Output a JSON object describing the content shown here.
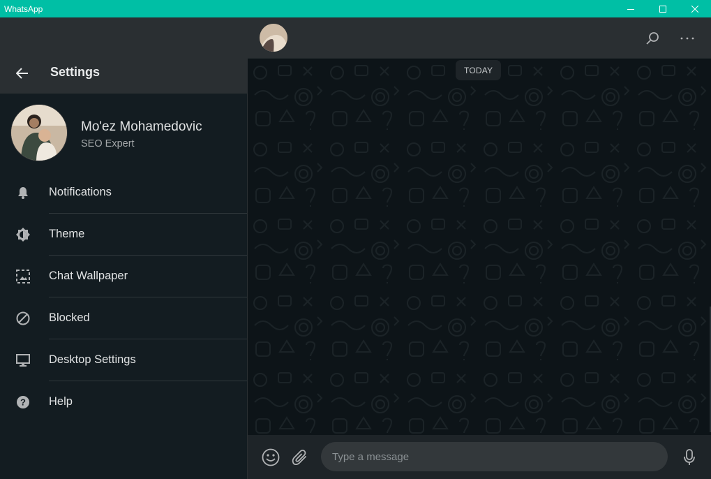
{
  "window": {
    "title": "WhatsApp",
    "controls": [
      "minimize-icon",
      "maximize-icon",
      "close-icon"
    ]
  },
  "settings": {
    "title": "Settings",
    "back_icon": "arrow-left-icon"
  },
  "profile": {
    "name": "Mo'ez Mohamedovic",
    "status": "SEO Expert"
  },
  "menu": {
    "items": [
      {
        "label": "Notifications",
        "icon": "bell-icon"
      },
      {
        "label": "Theme",
        "icon": "theme-icon"
      },
      {
        "label": "Chat Wallpaper",
        "icon": "wallpaper-icon"
      },
      {
        "label": "Blocked",
        "icon": "blocked-icon"
      },
      {
        "label": "Desktop Settings",
        "icon": "monitor-icon"
      },
      {
        "label": "Help",
        "icon": "help-icon"
      }
    ]
  },
  "chat": {
    "date_label": "TODAY",
    "header_icons": [
      "search-icon",
      "more-icon"
    ]
  },
  "compose": {
    "placeholder": "Type a message",
    "value": "",
    "icons": [
      "emoji-icon",
      "attach-icon",
      "mic-icon"
    ]
  },
  "colors": {
    "accent": "#00bfa5",
    "sidebar_bg": "#131c21",
    "header_bg": "#2a2f32",
    "chat_bg": "#0d1418"
  }
}
